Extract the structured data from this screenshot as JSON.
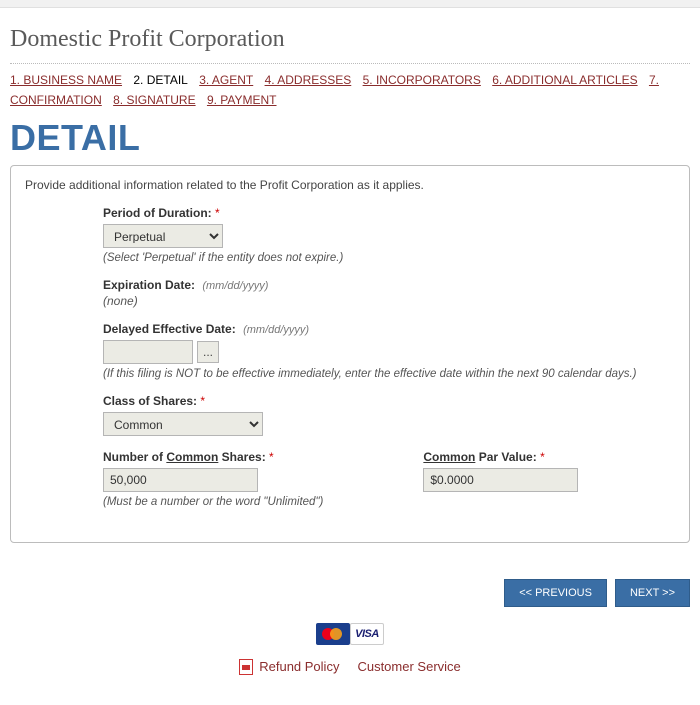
{
  "header": {
    "title": "Domestic Profit Corporation"
  },
  "steps": {
    "s1": "1. BUSINESS NAME",
    "s2": "2. DETAIL",
    "s3": "3. AGENT",
    "s4": "4. ADDRESSES",
    "s5": "5. INCORPORATORS",
    "s6": "6. ADDITIONAL ARTICLES",
    "s7": "7. CONFIRMATION",
    "s8": "8. SIGNATURE",
    "s9": "9. PAYMENT"
  },
  "section": {
    "title": "DETAIL",
    "intro": "Provide additional information related to the Profit Corporation as it applies."
  },
  "fields": {
    "period": {
      "label": "Period of Duration:",
      "value": "Perpetual",
      "hint": "(Select 'Perpetual' if the entity does not expire.)"
    },
    "expiration": {
      "label": "Expiration Date:",
      "format": "(mm/dd/yyyy)",
      "value": "(none)"
    },
    "delayed": {
      "label": "Delayed Effective Date:",
      "format": "(mm/dd/yyyy)",
      "value": "",
      "btn": "...",
      "hint": "(If this filing is NOT to be effective immediately, enter the effective date within the next 90 calendar days.)"
    },
    "class": {
      "label": "Class of Shares:",
      "value": "Common"
    },
    "numshares": {
      "label_pre": "Number of ",
      "label_ul": "Common",
      "label_post": " Shares:",
      "value": "50,000",
      "hint": "(Must be a number or the word \"Unlimited\")"
    },
    "parvalue": {
      "label_ul": "Common",
      "label_post": " Par Value:",
      "value": "$0.0000"
    }
  },
  "nav": {
    "prev": "<< PREVIOUS",
    "next": "NEXT >>"
  },
  "footer": {
    "visa": "VISA",
    "refund": "Refund Policy",
    "service": "Customer Service"
  }
}
